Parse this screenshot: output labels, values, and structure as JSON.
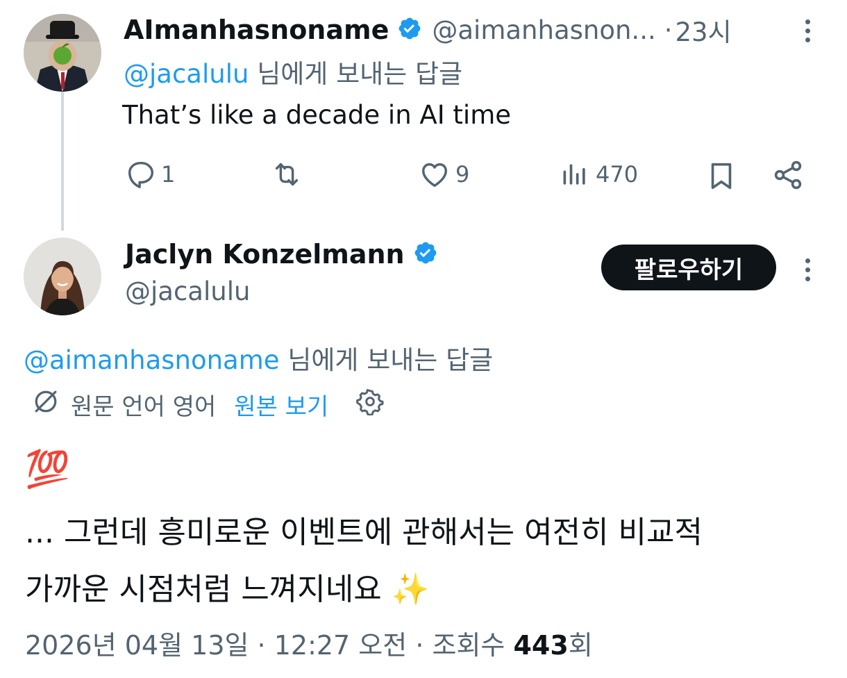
{
  "reply_tweet": {
    "display_name": "AImanhasnoname",
    "handle": "@aimanhasnon...",
    "time": "23시",
    "reply_to_mention": "@jacalulu",
    "reply_to_suffix": "님에게 보내는 답글",
    "text": "That’s like a decade in AI time",
    "actions": {
      "reply_count": "1",
      "retweet_count": "",
      "like_count": "9",
      "view_count": "470"
    }
  },
  "main_tweet": {
    "display_name": "Jaclyn Konzelmann",
    "handle": "@jacalulu",
    "follow_label": "팔로우하기",
    "reply_to_mention": "@aimanhasnoname",
    "reply_to_suffix": "님에게 보내는 답글",
    "translation": {
      "source_language": "원문 언어 영어",
      "view_original": "원본 보기"
    },
    "emoji": "💯",
    "text_line1": "... 그런데 흥미로운 이벤트에 관해서는 여전히 비교적",
    "text_line2": "가까운 시점처럼 느껴지네요 ✨",
    "meta": {
      "date": "2026년 04월 13일",
      "time": "12:27 오전",
      "views_label": "조회수",
      "views_count": "443",
      "views_suffix": "회"
    }
  },
  "colors": {
    "accent": "#1d9bf0",
    "text_primary": "#0f1419",
    "text_secondary": "#536471",
    "verified": "#1d9bf0",
    "button_bg": "#0f1419"
  },
  "icons": [
    "verified-badge-icon",
    "more-options-icon",
    "reply-icon",
    "retweet-icon",
    "like-icon",
    "views-icon",
    "bookmark-icon",
    "share-icon",
    "translate-icon",
    "settings-icon"
  ]
}
